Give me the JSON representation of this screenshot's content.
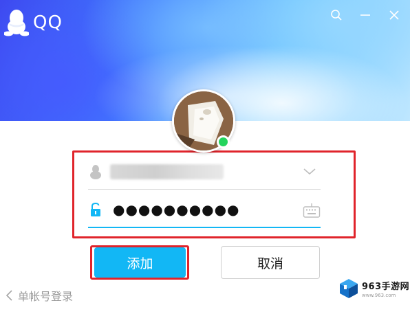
{
  "app": {
    "title": "QQ",
    "logo_icon": "qq-penguin-icon"
  },
  "window_controls": {
    "items": [
      "search-icon",
      "minimize-icon",
      "close-icon"
    ]
  },
  "profile": {
    "avatar": "user-avatar",
    "status": "online",
    "status_color": "#23d45c"
  },
  "login_form": {
    "account": {
      "value": "••••••••••••",
      "icon": "user-icon",
      "dropdown_icon": "chevron-down-icon"
    },
    "password": {
      "value": "●●●●●●●●●●",
      "icon": "unlock-icon",
      "keyboard_icon": "keyboard-icon"
    }
  },
  "actions": {
    "add_label": "添加",
    "cancel_label": "取消"
  },
  "footer": {
    "back_label": "单帐号登录"
  },
  "watermark": {
    "brand": "963手游网",
    "url": "www.963.com"
  },
  "colors": {
    "accent": "#12b7f5",
    "highlight": "#e0242b"
  }
}
